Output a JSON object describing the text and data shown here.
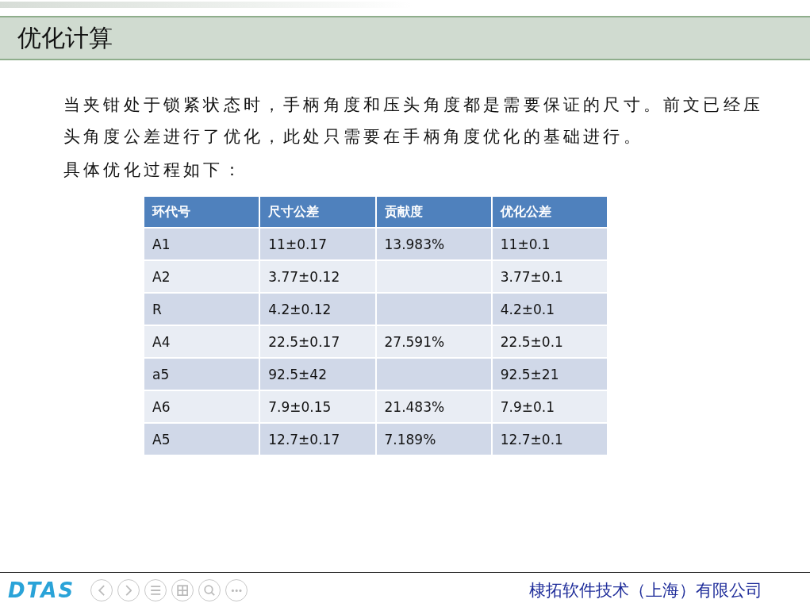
{
  "title": "优化计算",
  "paragraphs": [
    "当夹钳处于锁紧状态时，手柄角度和压头角度都是需要保证的尺寸。前文已经压头角度公差进行了优化，此处只需要在手柄角度优化的基础进行。",
    "具体优化过程如下："
  ],
  "table": {
    "columns": [
      "环代号",
      "尺寸公差",
      "贡献度",
      "优化公差"
    ],
    "rows": [
      [
        "A1",
        "11±0.17",
        "13.983%",
        "11±0.1"
      ],
      [
        "A2",
        "3.77±0.12",
        "",
        "3.77±0.1"
      ],
      [
        "R",
        "4.2±0.12",
        "",
        "4.2±0.1"
      ],
      [
        "A4",
        "22.5±0.17",
        "27.591%",
        "22.5±0.1"
      ],
      [
        "a5",
        "92.5±42",
        "",
        "92.5±21"
      ],
      [
        "A6",
        "7.9±0.15",
        "21.483%",
        "7.9±0.1"
      ],
      [
        "A5",
        "12.7±0.17",
        "7.189%",
        "12.7±0.1"
      ]
    ]
  },
  "footer": {
    "logo": "DTAS",
    "company": "棣拓软件技术（上海）有限公司"
  },
  "viewer_controls": [
    {
      "kind": "back"
    },
    {
      "kind": "forward"
    },
    {
      "kind": "menu"
    },
    {
      "kind": "slides"
    },
    {
      "kind": "zoom"
    },
    {
      "kind": "more"
    }
  ]
}
